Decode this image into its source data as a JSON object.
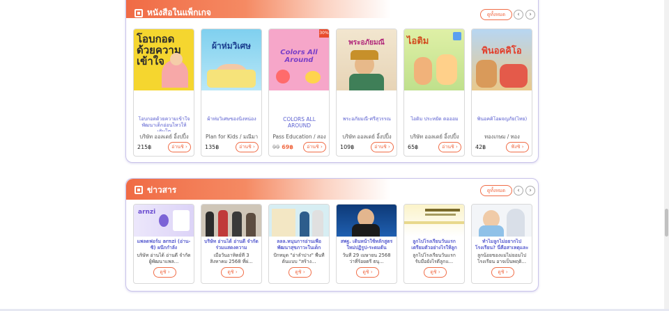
{
  "books_section": {
    "title": "หนังสือในแพ็กเกจ",
    "all_label": "ดูทั้งหมด",
    "items": [
      {
        "title": "โอบกอดด้วยความเข้าใจ พัฒนาเด็กอ่อนไหวให้เติบโต",
        "publisher": "บริษัท ออลเดย์ อิ้งปปิ้ง",
        "price": "215฿",
        "button": "อ่านชิ ›",
        "cover_text": "โอบกอด ด้วยความเข้าใจ"
      },
      {
        "title": "ผ้าห่มวิเศษของนิ้งหน่อง",
        "publisher": "Plan for Kids / มณีมา",
        "price": "135฿",
        "button": "อ่านชิ ›",
        "cover_text": "ผ้าห่มวิเศษ"
      },
      {
        "title": "COLORS ALL AROUND",
        "publisher": "Pass Education / สอง",
        "old_price": "99",
        "price": "69฿",
        "button": "อ่านชิ ›",
        "cover_text": "Colors All Around"
      },
      {
        "title": "พระอภัยมณี-ศรีสุวรรณ",
        "publisher": "บริษัท ออลเดย์ อิ้งปปิ้ง",
        "price": "109฿",
        "button": "อ่านชิ ›",
        "cover_text": "พระอภัยมณี"
      },
      {
        "title": "ไอติม ประหยัด ตอออม",
        "publisher": "บริษัท ออลเดย์ อิ้งปปิ้ง",
        "price": "65฿",
        "button": "อ่านชิ ›",
        "cover_text": "ไอติม"
      },
      {
        "title": "พินอคคิโอผจญภัย(ไทย)",
        "publisher": "ทองเกษม / ทอง",
        "price": "42฿",
        "button": "ฟังชิ ›",
        "cover_text": "พินอคคิโอ"
      }
    ]
  },
  "news_section": {
    "title": "ข่าวสาร",
    "all_label": "ดูทั้งหมด",
    "items": [
      {
        "title": "แพลตฟอร์ม arnzi (อ่าน-ซิ) ผนึกกำลัง",
        "desc": "บริษัท อ่านได้ อ่านดี จำกัด ผู้พัฒนาแพล...",
        "button": "ดูชิ ›"
      },
      {
        "title": "บริษัท อ่านได้ อ่านดี จำกัด ร่วมแสดงความ",
        "desc": "เมื่อวันอาทิตย์ที่ 3 สิงหาคม 2568 ที่ผ่...",
        "button": "ดูชิ ›"
      },
      {
        "title": "ลลล.หนุนการอ่านเพื่อ พัฒนาสุขภาวะในเด็ก",
        "desc": "ปักหมุด \"อ่าลำปาง\" พื้นที่ ต้นแบบ \"สร้าง...",
        "button": "ดูชิ ›"
      },
      {
        "title": "สพฐ. เดินหน้าใช้หลักสูตร ใหม่ปฏิรูป-ระดมต้น",
        "desc": "วันที่ 29 เมษายน 2568 ว่าที่ร้อยตรี ธนุ...",
        "button": "ดูชิ ›"
      },
      {
        "title": "ลูกไปโรงเรียนวันแรก เตรียมตัวอย่างไรให้ลูก",
        "desc": "ลูกไปโรงเรียนวันแรก รับมือยังไรดีลูกแ...",
        "button": "ดูชิ ›"
      },
      {
        "title": "ทำไมลูกไม่อยากไป โรงเรียน? นี่คือสาเหตุและ",
        "desc": "ลูกน้อยของแม่ไม่ยอมไป โรงเรียน อาจเป็นพฤติ...",
        "button": "ดูชิ ›"
      }
    ]
  },
  "thumb_logo": "arnzi",
  "colors": {
    "accent": "#f06b45",
    "title": "#5a5fd0",
    "border": "#c9c3ea"
  }
}
